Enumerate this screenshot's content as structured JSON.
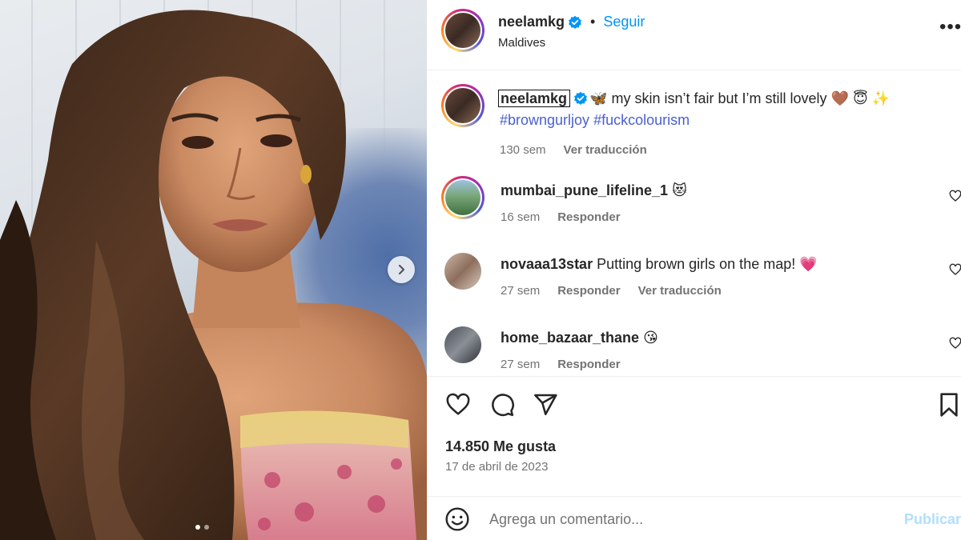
{
  "post": {
    "author": "neelamkg",
    "follow_label": "Seguir",
    "separator": "•",
    "location": "Maldives",
    "more_label": "•••"
  },
  "caption": {
    "username": "neelamkg",
    "emoji_lead": "🦋",
    "text": " my skin isn’t fair but I’m still lovely ",
    "emoji_tail": "🤎 😇 ✨",
    "hashtags": [
      "#browngurljoy",
      "#fuckcolourism"
    ],
    "time": "130 sem",
    "translate_label": "Ver traducción"
  },
  "comments": [
    {
      "username": "mumbai_pune_lifeline_1",
      "text": "😻",
      "time": "16 sem",
      "reply_label": "Responder"
    },
    {
      "username": "novaaa13star",
      "text": "Putting brown girls on the map! 💗",
      "time": "27 sem",
      "reply_label": "Responder",
      "translate_label": "Ver traducción"
    },
    {
      "username": "home_bazaar_thane",
      "text": "😘",
      "time": "27 sem",
      "reply_label": "Responder"
    }
  ],
  "stats": {
    "likes": "14.850 Me gusta",
    "date": "17 de abril de 2023"
  },
  "composer": {
    "placeholder": "Agrega un comentario...",
    "publish_label": "Publicar"
  },
  "carousel": {
    "total": 2,
    "active": 1
  },
  "colors": {
    "link_blue": "#0095f6",
    "hashtag_blue": "#4a5fd1",
    "secondary_text": "#737373",
    "verified_blue": "#0095f6",
    "publish_disabled": "#b2dffc"
  },
  "icons": {
    "verified": "verified-badge-icon",
    "more": "more-options-icon",
    "like": "heart-icon",
    "comment": "comment-bubble-icon",
    "share": "paper-plane-icon",
    "save": "bookmark-icon",
    "emoji": "smiley-icon",
    "carousel_next": "chevron-right-icon"
  }
}
